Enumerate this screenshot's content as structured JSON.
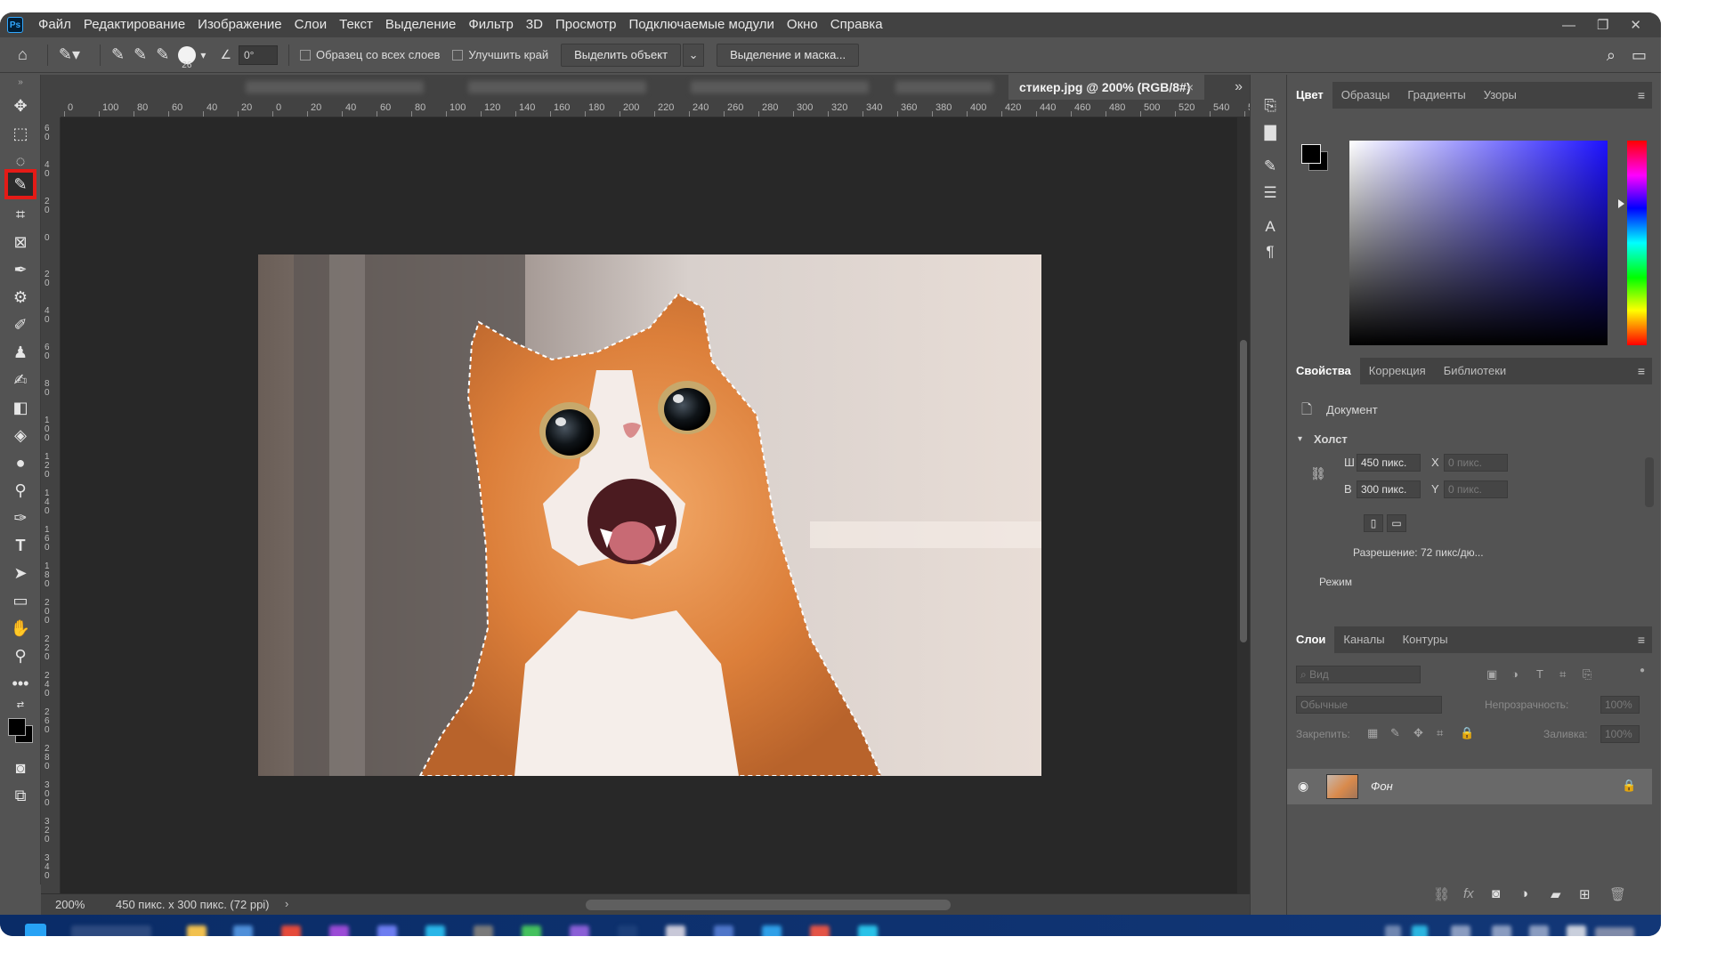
{
  "app": {
    "logo": "Ps",
    "menu": [
      "Файл",
      "Редактирование",
      "Изображение",
      "Слои",
      "Текст",
      "Выделение",
      "Фильтр",
      "3D",
      "Просмотр",
      "Подключаемые модули",
      "Окно",
      "Справка"
    ],
    "window_controls": [
      "—",
      "❐",
      "✕"
    ]
  },
  "options_bar": {
    "brush_size": "26",
    "angle": "0°",
    "sample_all_layers": "Образец со всех слоев",
    "enhance_edge": "Улучшить край",
    "select_subject": "Выделить объект",
    "select_and_mask": "Выделение и маска..."
  },
  "document": {
    "tab_title": "стикер.jpg @ 200% (RGB/8#)",
    "tab_close": "×",
    "zoom": "200%",
    "info": "450 пикс. x 300 пикс. (72 ppi)",
    "info_arrow": "›"
  },
  "ruler": {
    "h_labels": [
      "0",
      "100",
      "80",
      "60",
      "40",
      "20",
      "0",
      "20",
      "40",
      "60",
      "80",
      "100",
      "120",
      "140",
      "160",
      "180",
      "200",
      "220",
      "240",
      "260",
      "280",
      "300",
      "320",
      "340",
      "360",
      "380",
      "400",
      "420",
      "440",
      "460",
      "480",
      "500",
      "520",
      "540",
      "5"
    ],
    "v_labels": [
      "60",
      "40",
      "20",
      "0",
      "20",
      "40",
      "60",
      "80",
      "100",
      "120",
      "140",
      "160",
      "180",
      "200",
      "220",
      "240",
      "260",
      "280",
      "300",
      "320",
      "340"
    ]
  },
  "color_panel": {
    "tabs": [
      "Цвет",
      "Образцы",
      "Градиенты",
      "Узоры"
    ],
    "fg_color": "#000000",
    "bg_color": "#000000"
  },
  "properties_panel": {
    "tabs": [
      "Свойства",
      "Коррекция",
      "Библиотеки"
    ],
    "doc_label": "Документ",
    "canvas_section": "Холст",
    "w_label": "Ш",
    "h_label": "В",
    "x_label": "X",
    "y_label": "Y",
    "width": "450 пикс.",
    "height": "300 пикс.",
    "x_value": "0 пикс.",
    "y_value": "0 пикс.",
    "resolution": "Разрешение: 72 пикс/дю...",
    "mode": "Режим"
  },
  "layers_panel": {
    "tabs": [
      "Слои",
      "Каналы",
      "Контуры"
    ],
    "search_placeholder": "Вид",
    "blend_mode": "Обычные",
    "opacity_label": "Непрозрачность:",
    "opacity": "100%",
    "lock_label": "Закрепить:",
    "fill_label": "Заливка:",
    "fill": "100%",
    "layer_name": "Фон"
  }
}
